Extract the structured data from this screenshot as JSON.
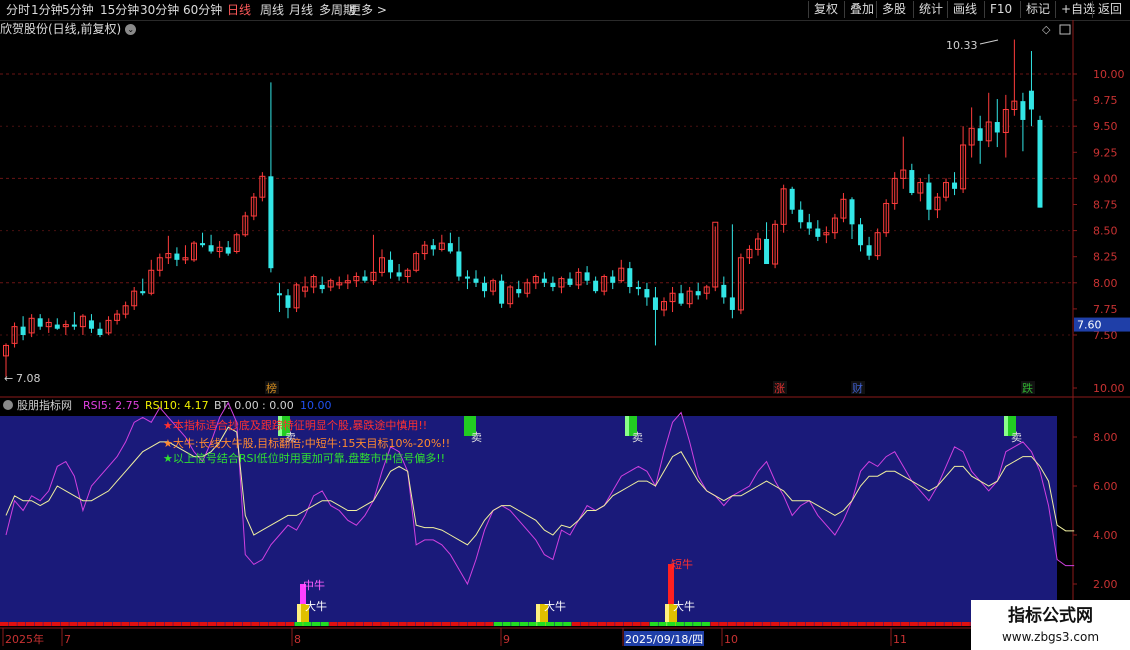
{
  "toolbar": {
    "left_items": [
      "分时",
      "1分钟",
      "5分钟",
      "15分钟",
      "30分钟",
      "60分钟",
      "日线",
      "周线",
      "月线",
      "多周期",
      "更多 >"
    ],
    "active": "日线",
    "right_items": [
      "复权",
      "叠加",
      "多股",
      "统计",
      "画线",
      "F10",
      "标记",
      "+自选",
      "返回"
    ]
  },
  "main_chart": {
    "title": "欣贺股份(日线,前复权)",
    "high_label": "10.33",
    "low_label": "7.08",
    "price_tag": "7.60",
    "y_ticks": [
      "10.00",
      "9.75",
      "9.50",
      "9.25",
      "9.00",
      "8.75",
      "8.50",
      "8.25",
      "8.00",
      "7.75",
      "7.50"
    ],
    "event_markers": [
      {
        "label": "榜",
        "color": "#d08a20"
      },
      {
        "label": "涨",
        "color": "#e03030"
      },
      {
        "label": "财",
        "color": "#4060d0"
      },
      {
        "label": "跌",
        "color": "#30b030"
      }
    ]
  },
  "indicator": {
    "name": "股朋指标网",
    "rsi5": "RSI5: 2.75",
    "rsi10": "RSI10: 4.17",
    "bt": "BT: 0.00",
    "v1": ": 0.00",
    "v2": "10.00",
    "y_ticks": [
      "10.00",
      "8.00",
      "6.00",
      "4.00",
      "2.00"
    ],
    "notes": [
      "★本指标适合抄底及跟踪特征明显个股,暴跌途中慎用!!",
      "★大牛:长线大牛股,目标翻倍;中短牛:15天目标10%-20%!!",
      "★以上信号结合RSI低位时用更加可靠,盘整市中信号偏多!!"
    ],
    "signals": {
      "sell": "卖",
      "big_bull": "大牛",
      "mid_bull": "中牛",
      "short_bull": "短牛"
    }
  },
  "x_axis": {
    "labels": [
      "2025年",
      "7",
      "8",
      "9",
      "2025/09/18/四",
      "10",
      "11"
    ]
  },
  "watermark": {
    "line1": "指标公式网",
    "line2": "www.zbgs3.com"
  },
  "chart_data": {
    "type": "candlestick",
    "title": "欣贺股份(日线,前复权)",
    "ylim": [
      7.25,
      10.5
    ],
    "ohlc": [
      [
        7.3,
        7.42,
        7.1,
        7.4
      ],
      [
        7.42,
        7.62,
        7.38,
        7.58
      ],
      [
        7.58,
        7.68,
        7.45,
        7.5
      ],
      [
        7.52,
        7.7,
        7.48,
        7.66
      ],
      [
        7.66,
        7.7,
        7.55,
        7.58
      ],
      [
        7.58,
        7.66,
        7.52,
        7.62
      ],
      [
        7.6,
        7.66,
        7.55,
        7.56
      ],
      [
        7.58,
        7.64,
        7.5,
        7.6
      ],
      [
        7.6,
        7.72,
        7.55,
        7.58
      ],
      [
        7.58,
        7.7,
        7.5,
        7.68
      ],
      [
        7.64,
        7.7,
        7.52,
        7.56
      ],
      [
        7.56,
        7.62,
        7.48,
        7.5
      ],
      [
        7.52,
        7.68,
        7.5,
        7.64
      ],
      [
        7.64,
        7.74,
        7.6,
        7.7
      ],
      [
        7.7,
        7.82,
        7.66,
        7.78
      ],
      [
        7.78,
        7.96,
        7.74,
        7.92
      ],
      [
        7.92,
        8.04,
        7.88,
        7.9
      ],
      [
        7.9,
        8.22,
        7.88,
        8.12
      ],
      [
        8.12,
        8.28,
        8.06,
        8.24
      ],
      [
        8.24,
        8.45,
        8.18,
        8.28
      ],
      [
        8.28,
        8.34,
        8.16,
        8.22
      ],
      [
        8.22,
        8.36,
        8.18,
        8.24
      ],
      [
        8.22,
        8.4,
        8.2,
        8.38
      ],
      [
        8.38,
        8.48,
        8.34,
        8.36
      ],
      [
        8.36,
        8.46,
        8.28,
        8.3
      ],
      [
        8.3,
        8.4,
        8.24,
        8.34
      ],
      [
        8.34,
        8.4,
        8.26,
        8.28
      ],
      [
        8.3,
        8.48,
        8.28,
        8.46
      ],
      [
        8.46,
        8.68,
        8.44,
        8.64
      ],
      [
        8.64,
        8.86,
        8.6,
        8.82
      ],
      [
        8.82,
        9.06,
        8.78,
        9.02
      ],
      [
        9.02,
        9.92,
        8.1,
        8.14
      ],
      [
        7.9,
        8.0,
        7.72,
        7.88
      ],
      [
        7.88,
        7.94,
        7.66,
        7.76
      ],
      [
        7.76,
        8.0,
        7.72,
        7.98
      ],
      [
        7.92,
        8.06,
        7.86,
        7.96
      ],
      [
        7.96,
        8.08,
        7.9,
        8.06
      ],
      [
        7.98,
        8.06,
        7.9,
        7.94
      ],
      [
        7.96,
        8.04,
        7.92,
        8.02
      ],
      [
        7.98,
        8.06,
        7.94,
        8.0
      ],
      [
        8.0,
        8.08,
        7.94,
        8.02
      ],
      [
        8.02,
        8.1,
        7.96,
        8.06
      ],
      [
        8.06,
        8.12,
        8.0,
        8.02
      ],
      [
        8.02,
        8.46,
        7.98,
        8.1
      ],
      [
        8.1,
        8.32,
        8.06,
        8.24
      ],
      [
        8.22,
        8.3,
        8.04,
        8.1
      ],
      [
        8.1,
        8.18,
        8.02,
        8.06
      ],
      [
        8.06,
        8.14,
        8.0,
        8.12
      ],
      [
        8.12,
        8.3,
        8.1,
        8.28
      ],
      [
        8.28,
        8.4,
        8.22,
        8.36
      ],
      [
        8.36,
        8.42,
        8.26,
        8.32
      ],
      [
        8.32,
        8.46,
        8.3,
        8.38
      ],
      [
        8.38,
        8.48,
        8.28,
        8.3
      ],
      [
        8.3,
        8.44,
        8.02,
        8.06
      ],
      [
        8.06,
        8.12,
        7.94,
        8.04
      ],
      [
        8.04,
        8.12,
        7.96,
        8.0
      ],
      [
        8.0,
        8.06,
        7.86,
        7.92
      ],
      [
        7.92,
        8.04,
        7.88,
        8.02
      ],
      [
        8.02,
        8.08,
        7.76,
        7.8
      ],
      [
        7.8,
        7.98,
        7.76,
        7.96
      ],
      [
        7.94,
        8.02,
        7.86,
        7.9
      ],
      [
        7.9,
        8.04,
        7.86,
        8.0
      ],
      [
        8.0,
        8.08,
        7.94,
        8.06
      ],
      [
        8.04,
        8.1,
        7.96,
        8.0
      ],
      [
        8.0,
        8.06,
        7.92,
        7.96
      ],
      [
        7.96,
        8.06,
        7.9,
        8.04
      ],
      [
        8.04,
        8.1,
        7.96,
        7.98
      ],
      [
        7.98,
        8.14,
        7.94,
        8.1
      ],
      [
        8.1,
        8.16,
        7.98,
        8.02
      ],
      [
        8.02,
        8.06,
        7.9,
        7.92
      ],
      [
        7.92,
        8.08,
        7.88,
        8.06
      ],
      [
        8.06,
        8.12,
        7.94,
        8.0
      ],
      [
        8.02,
        8.22,
        8.0,
        8.14
      ],
      [
        8.14,
        8.2,
        7.9,
        7.96
      ],
      [
        7.96,
        8.02,
        7.88,
        7.94
      ],
      [
        7.94,
        8.0,
        7.78,
        7.86
      ],
      [
        7.86,
        7.96,
        7.4,
        7.74
      ],
      [
        7.74,
        7.86,
        7.68,
        7.82
      ],
      [
        7.82,
        7.96,
        7.72,
        7.9
      ],
      [
        7.9,
        7.98,
        7.78,
        7.8
      ],
      [
        7.8,
        7.96,
        7.76,
        7.92
      ],
      [
        7.92,
        8.0,
        7.84,
        7.88
      ],
      [
        7.9,
        7.98,
        7.84,
        7.96
      ],
      [
        7.96,
        8.54,
        7.92,
        8.58
      ],
      [
        7.98,
        8.06,
        7.8,
        7.86
      ],
      [
        7.86,
        8.56,
        7.66,
        7.74
      ],
      [
        7.74,
        8.28,
        7.7,
        8.24
      ],
      [
        8.24,
        8.36,
        8.18,
        8.32
      ],
      [
        8.32,
        8.48,
        8.26,
        8.42
      ],
      [
        8.42,
        8.58,
        8.4,
        8.18
      ],
      [
        8.18,
        8.6,
        8.14,
        8.56
      ],
      [
        8.56,
        8.94,
        8.48,
        8.9
      ],
      [
        8.9,
        8.92,
        8.66,
        8.7
      ],
      [
        8.7,
        8.78,
        8.52,
        8.58
      ],
      [
        8.58,
        8.66,
        8.46,
        8.52
      ],
      [
        8.52,
        8.6,
        8.4,
        8.44
      ],
      [
        8.46,
        8.54,
        8.38,
        8.48
      ],
      [
        8.48,
        8.66,
        8.42,
        8.62
      ],
      [
        8.62,
        8.86,
        8.58,
        8.8
      ],
      [
        8.8,
        8.82,
        8.42,
        8.56
      ],
      [
        8.56,
        8.62,
        8.3,
        8.36
      ],
      [
        8.36,
        8.44,
        8.22,
        8.26
      ],
      [
        8.26,
        8.52,
        8.22,
        8.48
      ],
      [
        8.48,
        8.8,
        8.44,
        8.76
      ],
      [
        8.76,
        9.06,
        8.7,
        9.0
      ],
      [
        9.0,
        9.4,
        8.9,
        9.08
      ],
      [
        9.08,
        9.14,
        8.84,
        8.86
      ],
      [
        8.86,
        9.0,
        8.78,
        8.96
      ],
      [
        8.96,
        9.04,
        8.6,
        8.7
      ],
      [
        8.7,
        8.86,
        8.62,
        8.82
      ],
      [
        8.82,
        9.0,
        8.78,
        8.96
      ],
      [
        8.96,
        9.06,
        8.84,
        8.9
      ],
      [
        8.9,
        9.5,
        8.86,
        9.32
      ],
      [
        9.32,
        9.68,
        9.2,
        9.48
      ],
      [
        9.48,
        9.6,
        9.14,
        9.36
      ],
      [
        9.36,
        9.82,
        9.3,
        9.54
      ],
      [
        9.54,
        9.76,
        9.3,
        9.44
      ],
      [
        9.44,
        9.8,
        9.2,
        9.66
      ],
      [
        9.66,
        10.33,
        9.6,
        9.74
      ],
      [
        9.74,
        9.82,
        9.26,
        9.56
      ],
      [
        9.84,
        10.22,
        9.5,
        9.66
      ],
      [
        9.56,
        9.6,
        8.72,
        8.72
      ]
    ],
    "rsi5": [
      4.0,
      5.4,
      5.0,
      5.6,
      5.4,
      5.8,
      6.8,
      7.0,
      6.4,
      5.0,
      6.0,
      6.4,
      6.8,
      7.2,
      7.8,
      8.6,
      8.8,
      8.6,
      9.2,
      8.8,
      8.4,
      8.0,
      7.4,
      7.0,
      7.8,
      8.8,
      9.4,
      8.6,
      3.2,
      2.8,
      3.0,
      3.6,
      4.0,
      4.4,
      4.2,
      4.8,
      5.6,
      5.8,
      5.2,
      5.0,
      4.6,
      4.4,
      4.8,
      5.4,
      6.6,
      7.6,
      7.4,
      6.6,
      3.6,
      3.8,
      3.8,
      3.6,
      3.2,
      2.6,
      2.0,
      3.0,
      4.2,
      5.0,
      5.2,
      5.0,
      4.6,
      4.2,
      3.8,
      3.2,
      3.0,
      4.2,
      4.0,
      4.6,
      5.2,
      5.0,
      5.2,
      5.8,
      6.4,
      6.6,
      6.8,
      6.6,
      6.0,
      7.4,
      8.6,
      9.0,
      7.8,
      6.4,
      5.8,
      5.6,
      5.2,
      5.6,
      5.8,
      6.0,
      6.6,
      7.0,
      6.2,
      5.6,
      4.8,
      5.2,
      5.4,
      4.8,
      4.4,
      4.0,
      4.6,
      5.4,
      6.6,
      7.0,
      6.8,
      7.2,
      7.4,
      6.8,
      6.2,
      5.8,
      5.4,
      6.0,
      6.8,
      7.6,
      7.4,
      6.6,
      6.2,
      5.8,
      6.2,
      7.4,
      7.6,
      7.8,
      7.4,
      6.6,
      5.2,
      3.0,
      2.75,
      2.75
    ],
    "rsi10": [
      4.8,
      5.6,
      5.4,
      5.4,
      5.2,
      5.4,
      6.0,
      5.8,
      5.6,
      5.4,
      5.4,
      5.6,
      5.8,
      6.2,
      6.6,
      7.0,
      7.4,
      7.6,
      7.8,
      7.8,
      7.6,
      7.4,
      7.2,
      7.2,
      7.4,
      7.8,
      8.4,
      8.2,
      4.8,
      4.0,
      4.2,
      4.4,
      4.6,
      4.8,
      4.8,
      5.0,
      5.2,
      5.4,
      5.4,
      5.2,
      5.0,
      5.0,
      5.2,
      5.4,
      6.0,
      6.6,
      6.8,
      6.6,
      4.4,
      4.3,
      4.3,
      4.2,
      4.0,
      3.8,
      3.6,
      4.0,
      4.6,
      5.0,
      5.2,
      5.2,
      5.0,
      4.8,
      4.6,
      4.2,
      4.0,
      4.4,
      4.3,
      4.6,
      5.0,
      5.0,
      5.2,
      5.6,
      5.8,
      6.0,
      6.2,
      6.2,
      6.0,
      6.6,
      7.2,
      7.4,
      6.8,
      6.2,
      5.8,
      5.6,
      5.4,
      5.6,
      5.6,
      5.8,
      6.0,
      6.2,
      6.0,
      5.8,
      5.4,
      5.4,
      5.4,
      5.2,
      5.0,
      4.8,
      5.0,
      5.4,
      6.0,
      6.4,
      6.4,
      6.6,
      6.6,
      6.4,
      6.2,
      6.0,
      5.8,
      6.0,
      6.4,
      6.8,
      6.8,
      6.4,
      6.2,
      6.0,
      6.2,
      6.8,
      7.0,
      7.2,
      7.2,
      6.8,
      6.2,
      4.4,
      4.17,
      4.17
    ]
  }
}
